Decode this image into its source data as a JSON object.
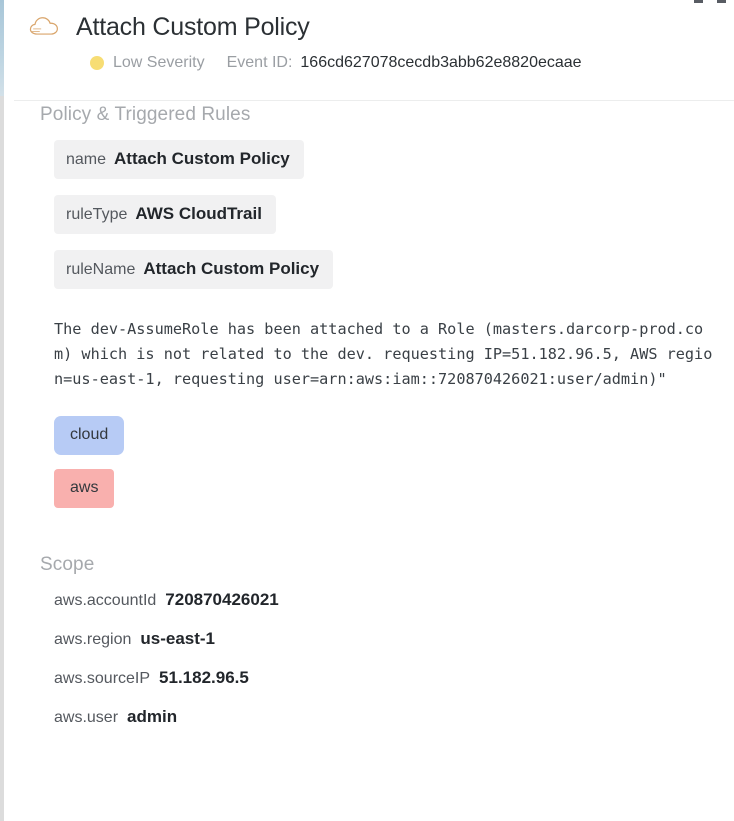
{
  "window_controls": [
    {
      "name": "minimize-control"
    },
    {
      "name": "close-control"
    }
  ],
  "header": {
    "icon": "cloud-icon",
    "icon_color": "#d9a56b",
    "title": "Attach Custom Policy",
    "severity": {
      "label": "Low Severity",
      "dot_color": "#f7dd74",
      "level": "Low"
    },
    "event_id_label": "Event ID:",
    "event_id_value": "166cd627078cecdb3abb62e8820ecaae"
  },
  "policy_section": {
    "heading": "Policy & Triggered Rules",
    "rules": [
      {
        "key": "name",
        "value": "Attach Custom Policy"
      },
      {
        "key": "ruleType",
        "value": "AWS CloudTrail"
      },
      {
        "key": "ruleName",
        "value": "Attach Custom Policy"
      }
    ],
    "description": "The dev-AssumeRole has been attached to a Role (masters.darcorp-prod.com) which is not related to the dev. requesting IP=51.182.96.5, AWS region=us-east-1, requesting user=arn:aws:iam::720870426021:user/admin)\""
  },
  "tags": [
    {
      "label": "cloud",
      "color": "#b7cbf5"
    },
    {
      "label": "aws",
      "color": "#f9b0ae"
    }
  ],
  "scope_section": {
    "heading": "Scope",
    "fields": [
      {
        "key": "aws.accountId",
        "value": "720870426021"
      },
      {
        "key": "aws.region",
        "value": "us-east-1"
      },
      {
        "key": "aws.sourceIP",
        "value": "51.182.96.5"
      },
      {
        "key": "aws.user",
        "value": "admin"
      }
    ]
  }
}
